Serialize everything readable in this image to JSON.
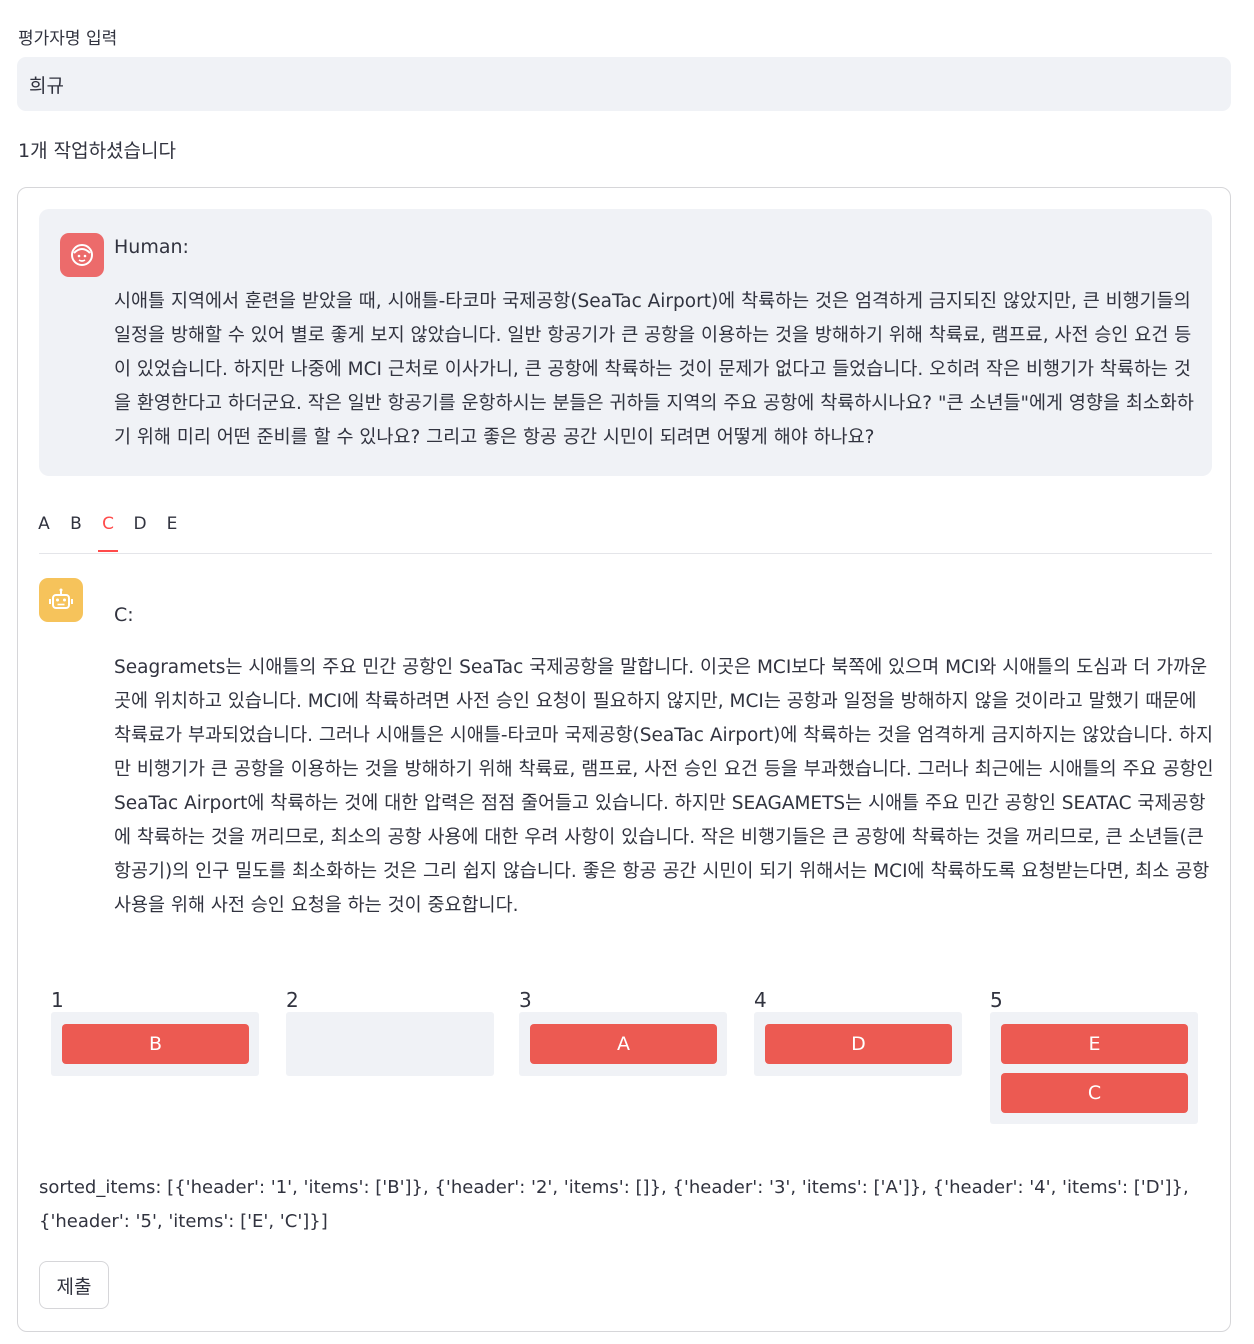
{
  "evaluator": {
    "label": "평가자명 입력",
    "value": "희규"
  },
  "work_count_text": "1개 작업하셨습니다",
  "human_message": {
    "role": "Human:",
    "icon": "smiley-face-icon",
    "text": "시애틀 지역에서 훈련을 받았을 때, 시애틀-타코마 국제공항(SeaTac Airport)에 착륙하는 것은 엄격하게 금지되진 않았지만, 큰 비행기들의 일정을 방해할 수 있어 별로 좋게 보지 않았습니다. 일반 항공기가 큰 공항을 이용하는 것을 방해하기 위해 착륙료, 램프료, 사전 승인 요건 등이 있었습니다. 하지만 나중에 MCI 근처로 이사가니, 큰 공항에 착륙하는 것이 문제가 없다고 들었습니다. 오히려 작은 비행기가 착륙하는 것을 환영한다고 하더군요. 작은 일반 항공기를 운항하시는 분들은 귀하들 지역의 주요 공항에 착륙하시나요? \"큰 소년들\"에게 영향을 최소화하기 위해 미리 어떤 준비를 할 수 있나요? 그리고 좋은 항공 공간 시민이 되려면 어떻게 해야 하나요?"
  },
  "tabs": [
    "A",
    "B",
    "C",
    "D",
    "E"
  ],
  "active_tab": "C",
  "bot_message": {
    "role": "C:",
    "icon": "robot-icon",
    "text": "Seagramets는 시애틀의 주요 민간 공항인 SeaTac 국제공항을 말합니다. 이곳은 MCI보다 북쪽에 있으며 MCI와 시애틀의 도심과 더 가까운 곳에 위치하고 있습니다. MCI에 착륙하려면 사전 승인 요청이 필요하지 않지만, MCI는 공항과 일정을 방해하지 않을 것이라고 말했기 때문에 착륙료가 부과되었습니다. 그러나 시애틀은 시애틀-타코마 국제공항(SeaTac Airport)에 착륙하는 것을 엄격하게 금지하지는 않았습니다. 하지만 비행기가 큰 공항을 이용하는 것을 방해하기 위해 착륙료, 램프료, 사전 승인 요건 등을 부과했습니다. 그러나 최근에는 시애틀의 주요 공항인 SeaTac Airport에 착륙하는 것에 대한 압력은 점점 줄어들고 있습니다. 하지만 SEAGAMETS는 시애틀 주요 민간 공항인 SEATAC 국제공항에 착륙하는 것을 꺼리므로, 최소의 공항 사용에 대한 우려 사항이 있습니다. 작은 비행기들은 큰 공항에 착륙하는 것을 꺼리므로, 큰 소년들(큰 항공기)의 인구 밀도를 최소화하는 것은 그리 쉽지 않습니다. 좋은 항공 공간 시민이 되기 위해서는 MCI에 착륙하도록 요청받는다면, 최소 공항 사용을 위해 사전 승인 요청을 하는 것이 중요합니다."
  },
  "ranking": [
    {
      "header": "1",
      "items": [
        "B"
      ]
    },
    {
      "header": "2",
      "items": []
    },
    {
      "header": "3",
      "items": [
        "A"
      ]
    },
    {
      "header": "4",
      "items": [
        "D"
      ]
    },
    {
      "header": "5",
      "items": [
        "E",
        "C"
      ]
    }
  ],
  "sorted_items_text": "sorted_items: [{'header': '1', 'items': ['B']}, {'header': '2', 'items': []}, {'header': '3', 'items': ['A']}, {'header': '4', 'items': ['D']}, {'header': '5', 'items': ['E', 'C']}]",
  "submit_label": "제출",
  "colors": {
    "accent": "#ff4b4b",
    "sort_item": "#ec5a52",
    "human_avatar": "#ec6b6b",
    "bot_avatar": "#f6c35b"
  }
}
